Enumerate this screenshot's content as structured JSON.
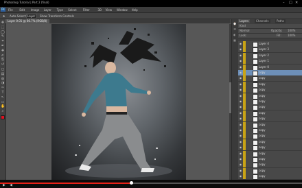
{
  "window": {
    "title": "Photoshop Tutorial | Part 2 (final)",
    "minimize_glyph": "–",
    "maximize_glyph": "□",
    "close_glyph": "✕"
  },
  "app": {
    "logo_text": "Ps",
    "menus": [
      "File",
      "Edit",
      "Image",
      "Layer",
      "Type",
      "Select",
      "Filter",
      "3D",
      "View",
      "Window",
      "Help"
    ]
  },
  "options_bar": {
    "label1": "Auto-Select:",
    "value1": "Layer",
    "label2": "Show Transform Controls"
  },
  "document": {
    "tab_label": "Layer 0.01 @ 66.7% (RGB/8)"
  },
  "tools": [
    "move",
    "marquee",
    "lasso",
    "quick-select",
    "crop",
    "eyedropper",
    "healing",
    "brush",
    "clone",
    "history",
    "eraser",
    "gradient",
    "blur",
    "dodge",
    "pen",
    "type",
    "path-select",
    "shape",
    "hand",
    "zoom"
  ],
  "colors": {
    "foreground": "#e01020",
    "background": "#ffffff",
    "accent_selected": "#6d8fb8",
    "layer_color_label": "#c8a316",
    "progress": "#e62117"
  },
  "layers_panel": {
    "tabs": [
      "Layers",
      "Channels",
      "Paths"
    ],
    "kind_label": "Kind",
    "blend_mode": "Normal",
    "opacity_label": "Opacity:",
    "opacity_value": "100%",
    "lock_label": "Lock:",
    "fill_label": "Fill:",
    "fill_value": "100%",
    "selected_index": 5,
    "layers": [
      {
        "name": "Layer 4"
      },
      {
        "name": "Layer 3"
      },
      {
        "name": "Layer 2"
      },
      {
        "name": "Layer 1"
      },
      {
        "name": "Layer 0"
      },
      {
        "name": "copy"
      },
      {
        "name": "copy"
      },
      {
        "name": "copy"
      },
      {
        "name": "copy"
      },
      {
        "name": "copy"
      },
      {
        "name": "copy"
      },
      {
        "name": "copy"
      },
      {
        "name": "copy"
      },
      {
        "name": "copy"
      },
      {
        "name": "copy"
      },
      {
        "name": "copy"
      },
      {
        "name": "copy"
      },
      {
        "name": "copy"
      },
      {
        "name": "copy"
      },
      {
        "name": "copy"
      },
      {
        "name": "copy"
      },
      {
        "name": "copy"
      },
      {
        "name": "copy"
      },
      {
        "name": "copy"
      }
    ]
  },
  "video": {
    "progress_fraction": 0.436,
    "play_glyph": "▶",
    "volume_glyph": "◀"
  }
}
